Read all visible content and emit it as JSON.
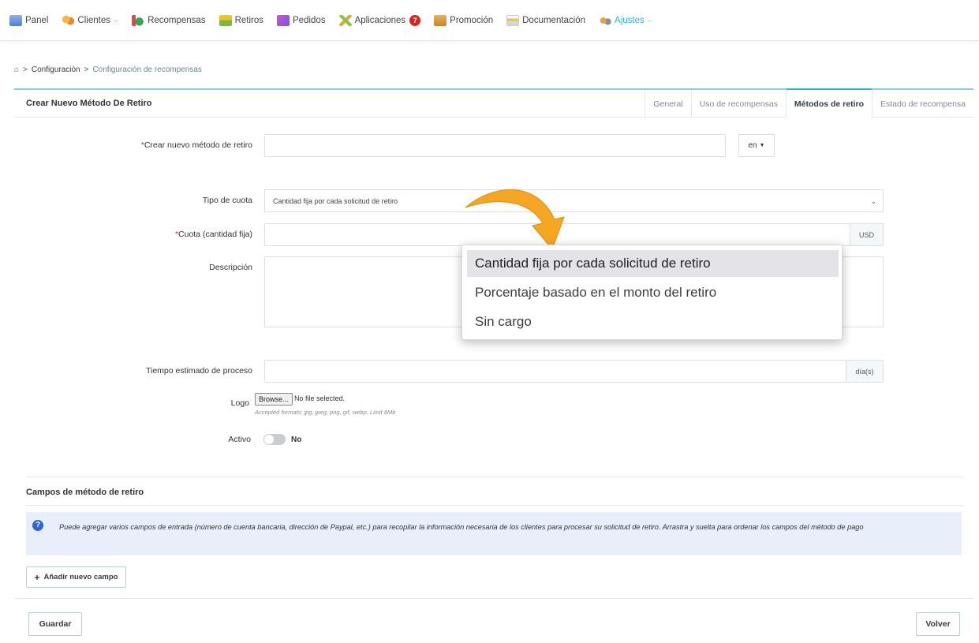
{
  "nav": {
    "items": [
      {
        "label": "Panel",
        "icon": "dashboard-icon"
      },
      {
        "label": "Clientes",
        "icon": "customers-icon",
        "dropdown": true
      },
      {
        "label": "Recompensas",
        "icon": "rewards-icon"
      },
      {
        "label": "Retiros",
        "icon": "withdrawals-icon"
      },
      {
        "label": "Pedidos",
        "icon": "orders-icon"
      },
      {
        "label": "Aplicaciones",
        "icon": "apps-icon",
        "badge": "7"
      },
      {
        "label": "Promoción",
        "icon": "promotion-icon"
      },
      {
        "label": "Documentación",
        "icon": "documentation-icon"
      },
      {
        "label": "Ajustes",
        "icon": "settings-icon",
        "dropdown": true,
        "active": true
      }
    ]
  },
  "breadcrumb": {
    "sep": ">",
    "link": "Configuración",
    "current": "Configuración de recompensas"
  },
  "panel": {
    "title": "Crear Nuevo Método De Retiro",
    "tabs": [
      "General",
      "Uso de recompensas",
      "Métodos de retiro",
      "Estado de recompensa"
    ],
    "active_tab": "Métodos de retiro"
  },
  "form": {
    "method_name_label": "Crear nuevo método de retiro",
    "method_name_value": "",
    "lang": "en",
    "fee_type_label": "Tipo de cuota",
    "fee_type_value": "Cantidad fija por cada solicitud de retiro",
    "fee_amount_label": "Cuota (cantidad fija)",
    "fee_amount_value": "",
    "currency": "USD",
    "description_label": "Descripción",
    "description_value": "",
    "processing_time_label": "Tiempo estimado de proceso",
    "processing_time_value": "",
    "processing_time_unit": "día(s)",
    "logo_label": "Logo",
    "browse_label": "Browse...",
    "no_file": "No file selected.",
    "formats_hint": "Accepted formats: jpg, jpeg, png, gif, webp. Limit 8Mb",
    "active_label": "Activo",
    "active_value": "No",
    "required_mark": "*"
  },
  "dropdown": {
    "options": [
      "Cantidad fija por cada solicitud de retiro",
      "Porcentaje basado en el monto del retiro",
      "Sin cargo"
    ],
    "selected": "Cantidad fija por cada solicitud de retiro"
  },
  "fields_section": {
    "title": "Campos de método de retiro",
    "info": "Puede agregar varios campos de entrada (número de cuenta bancaria, dirección de Paypal, etc.) para recopilar la información necesaria de los clientes para procesar su solicitud de retiro. Arrastra y suelta para ordenar los campos del método de pago",
    "add_button": "Añadir nuevo campo"
  },
  "footer": {
    "save": "Guardar",
    "back": "Volver"
  },
  "colors": {
    "accent": "#25b9d7",
    "badge": "#d9231e",
    "info_bg": "#e9eefb",
    "arrow": "#f5a623"
  }
}
